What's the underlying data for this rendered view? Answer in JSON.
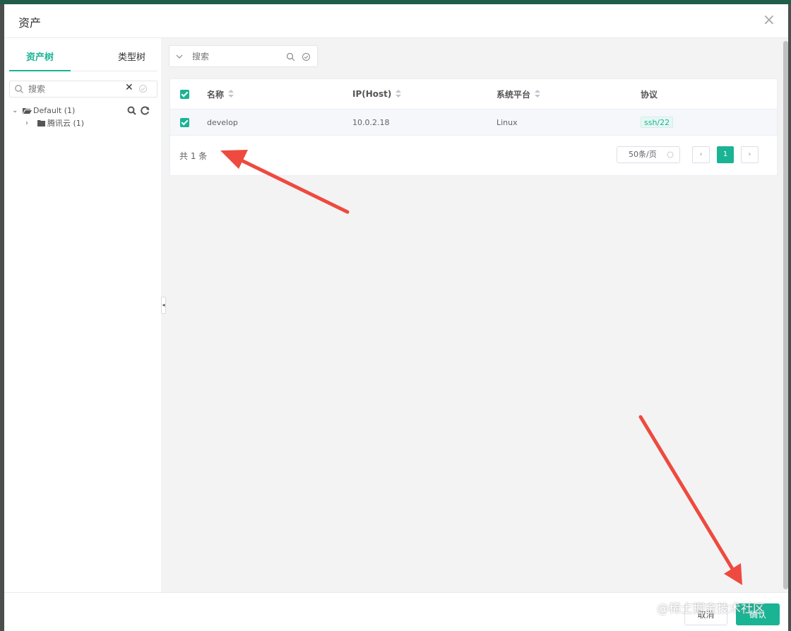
{
  "dialog": {
    "title": "资产",
    "close_glyph": "×"
  },
  "left_panel": {
    "tabs": [
      {
        "label": "资产树",
        "active": true
      },
      {
        "label": "类型树",
        "active": false
      }
    ],
    "search": {
      "placeholder": "搜索",
      "clear_glyph": "✕"
    },
    "tree": [
      {
        "label": "Default (1)",
        "expanded": true,
        "icon": "folder-open-icon"
      },
      {
        "label": "腾讯云 (1)",
        "expanded": false,
        "icon": "folder-icon"
      }
    ],
    "collapse_glyph": "◂"
  },
  "asset_search": {
    "placeholder": "搜索"
  },
  "table": {
    "columns": [
      {
        "label": "名称",
        "sortable": true
      },
      {
        "label": "IP(Host)",
        "sortable": true
      },
      {
        "label": "系统平台",
        "sortable": true
      },
      {
        "label": "协议",
        "sortable": false
      }
    ],
    "rows": [
      {
        "name": "develop",
        "ip": "10.0.2.18",
        "platform": "Linux",
        "protocol": "ssh/22",
        "checked": true
      }
    ]
  },
  "pagination": {
    "total_text": "共 1 条",
    "page_size": "50条/页",
    "prev_glyph": "‹",
    "next_glyph": "›",
    "current_page": "1"
  },
  "footer": {
    "cancel_label": "取消",
    "confirm_label": "确认"
  },
  "watermark": "@稀土掘金技术社区",
  "colors": {
    "accent": "#1ab394",
    "annotation_arrow": "#ee4a3f"
  }
}
